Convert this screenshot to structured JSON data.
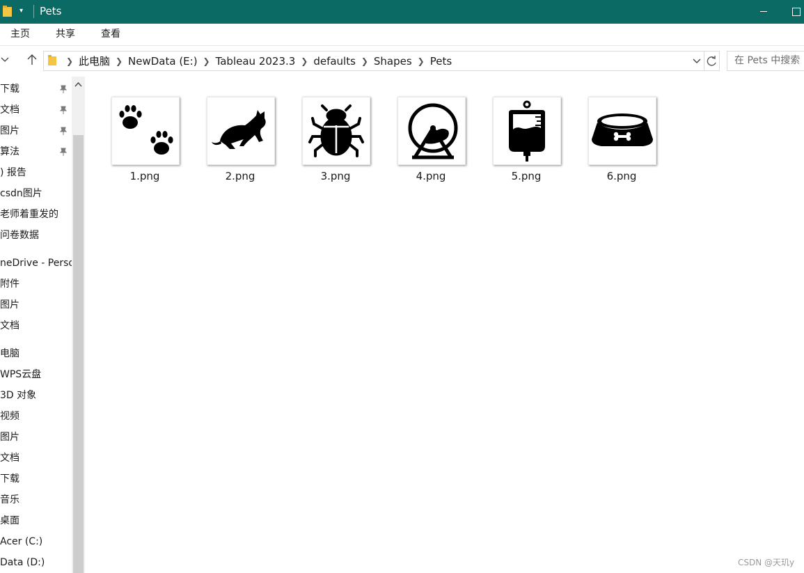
{
  "window": {
    "title": "Pets"
  },
  "ribbon": {
    "tabs": [
      "主页",
      "共享",
      "查看"
    ]
  },
  "address": {
    "crumbs": [
      "此电脑",
      "NewData (E:)",
      "Tableau 2023.3",
      "defaults",
      "Shapes",
      "Pets"
    ]
  },
  "search": {
    "placeholder": "在 Pets 中搜索"
  },
  "nav": {
    "items": [
      {
        "label": "下载",
        "pinned": true
      },
      {
        "label": "文档",
        "pinned": true
      },
      {
        "label": "图片",
        "pinned": true
      },
      {
        "label": "算法",
        "pinned": true
      },
      {
        "label": ") 报告",
        "pinned": false
      },
      {
        "label": "csdn图片",
        "pinned": false
      },
      {
        "label": "老师着重发的",
        "pinned": false
      },
      {
        "label": "问卷数据",
        "pinned": false
      },
      {
        "label": "neDrive - Perso",
        "pinned": false
      },
      {
        "label": "附件",
        "pinned": false
      },
      {
        "label": "图片",
        "pinned": false
      },
      {
        "label": "文档",
        "pinned": false
      },
      {
        "label": "电脑",
        "pinned": false
      },
      {
        "label": "WPS云盘",
        "pinned": false
      },
      {
        "label": "3D 对象",
        "pinned": false
      },
      {
        "label": "视频",
        "pinned": false
      },
      {
        "label": "图片",
        "pinned": false
      },
      {
        "label": "文档",
        "pinned": false
      },
      {
        "label": "下载",
        "pinned": false
      },
      {
        "label": "音乐",
        "pinned": false
      },
      {
        "label": "桌面",
        "pinned": false
      },
      {
        "label": "Acer (C:)",
        "pinned": false
      },
      {
        "label": "Data (D:)",
        "pinned": false
      }
    ]
  },
  "files": [
    {
      "name": "1.png",
      "icon": "paws-icon"
    },
    {
      "name": "2.png",
      "icon": "cat-icon"
    },
    {
      "name": "3.png",
      "icon": "beetle-icon"
    },
    {
      "name": "4.png",
      "icon": "hamster-wheel-icon"
    },
    {
      "name": "5.png",
      "icon": "iv-bag-icon"
    },
    {
      "name": "6.png",
      "icon": "pet-bowl-icon"
    }
  ],
  "watermark": "CSDN @天玑y",
  "colors": {
    "titlebar": "#0b6a63",
    "folder": "#f4c542"
  }
}
